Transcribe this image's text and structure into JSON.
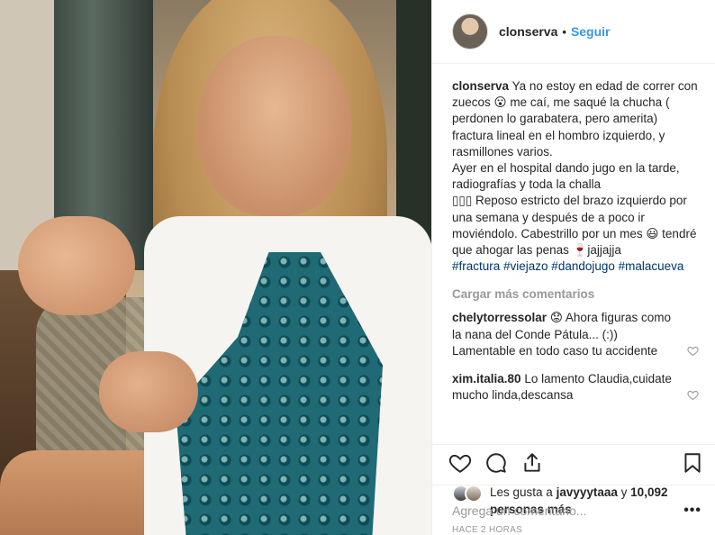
{
  "post": {
    "username": "clonserva",
    "follow_label": "Seguir",
    "separator": "•",
    "caption": {
      "username": "clonserva",
      "text": "Ya no estoy en edad de correr con zuecos 😮 me caí, me saqué la chucha ( perdonen lo garabatera, pero amerita) fractura lineal en el hombro izquierdo, y rasmillones varios.",
      "text2": "Ayer en el hospital dando jugo en la tarde, radiografías y toda la challa",
      "text3": "▯▯▯ Reposo estricto del brazo izquierdo por una semana y después de a poco ir moviéndolo. Cabestrillo por un mes 😃 tendré que ahogar las penas 🍷jajjajja",
      "hashtags": "#fractura #viejazo #dandojugo #malacueva"
    },
    "load_more": "Cargar más comentarios",
    "comments": [
      {
        "username": "chelytorressolar",
        "text": "😟 Ahora figuras como la nana del Conde Pátula... (:)) Lamentable en todo caso tu accidente"
      },
      {
        "username": "xim.italia.80",
        "text": "Lo lamento Claudia,cuidate mucho linda,descansa"
      }
    ],
    "likes": {
      "prefix": "Les gusta a",
      "user": "javyyytaaa",
      "conj": "y",
      "count": "10,092 personas más"
    },
    "timestamp": "HACE 2 HORAS",
    "add_comment_placeholder": "Agrega un comentario...",
    "options_label": "•••"
  },
  "icons": [
    "heart-icon",
    "comment-icon",
    "share-icon",
    "bookmark-icon",
    "small-heart-icon",
    "more-options-icon"
  ],
  "colors": {
    "link": "#3897f0",
    "muted": "#999999",
    "text": "#262626",
    "hashtag": "#003569"
  }
}
